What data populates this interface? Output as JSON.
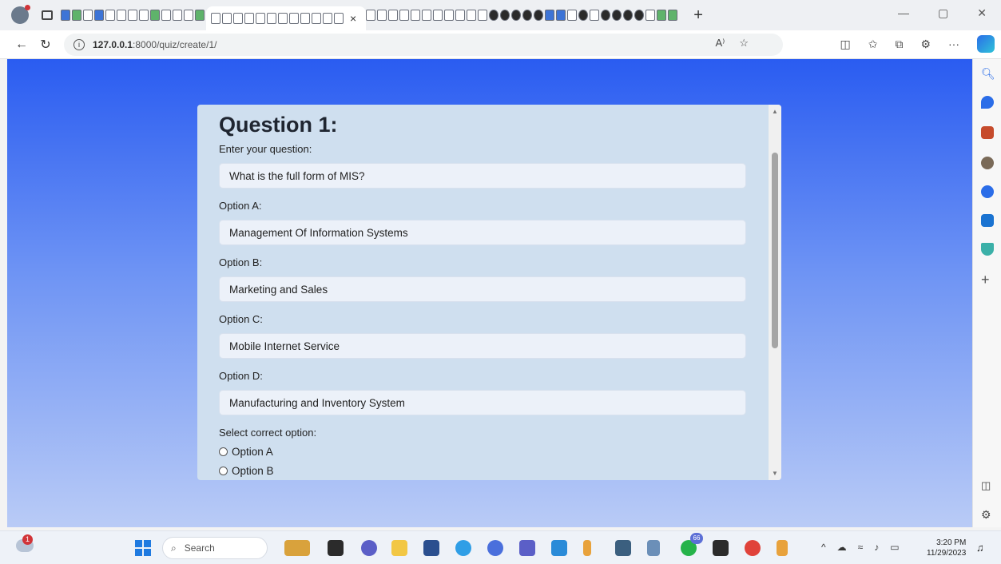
{
  "browser": {
    "new_tab": "+",
    "close_tab": "×",
    "window_min": "—",
    "window_max": "▢",
    "window_close": "✕",
    "url_host": "127.0.0.1",
    "url_path": ":8000/quiz/create/1/",
    "read_aloud_label": "A⁾",
    "more_label": "···"
  },
  "quiz": {
    "title": "Question 1:",
    "question_label": "Enter your question:",
    "question_value": "What is the full form of MIS?",
    "options": [
      {
        "label": "Option A:",
        "value": "Management Of Information Systems"
      },
      {
        "label": "Option B:",
        "value": "Marketing and Sales"
      },
      {
        "label": "Option C:",
        "value": "Mobile Internet Service"
      },
      {
        "label": "Option D:",
        "value": "Manufacturing and Inventory System"
      }
    ],
    "correct_label": "Select correct option:",
    "radio_options": [
      "Option A",
      "Option B"
    ]
  },
  "taskbar": {
    "weather_badge": "1",
    "search_placeholder": "Search",
    "whatsapp_badge": "66",
    "time": "3:20 PM",
    "date": "11/29/2023"
  },
  "colors": {
    "page_gradient_top": "#2a5cf1",
    "card_bg": "#cfdfef",
    "field_bg": "#ecf1f9"
  }
}
